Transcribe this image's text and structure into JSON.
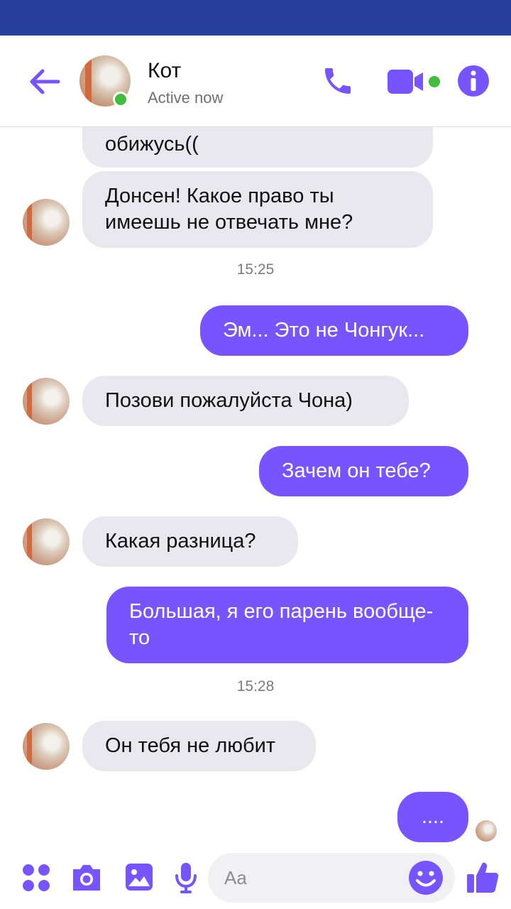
{
  "contact": {
    "name": "Кот",
    "status": "Active now"
  },
  "messages": {
    "m1_partial": "обижусь((",
    "m2": "Донсен! Какое право ты имеешь не отвечать мне?",
    "time1": "15:25",
    "m3": "Эм... Это не Чонгук...",
    "m4": "Позови пожалуйста Чона)",
    "m5": "Зачем он тебе?",
    "m6": "Какая разница?",
    "m7": "Большая, я его парень вообще-то",
    "time2": "15:28",
    "m8": "Он тебя не любит",
    "m9": "...."
  },
  "composer": {
    "placeholder": "Aa"
  },
  "colors": {
    "accent": "#7654ff",
    "online": "#3fbd3b",
    "statusbar": "#263f9a",
    "incoming": "#e9e8ef"
  }
}
